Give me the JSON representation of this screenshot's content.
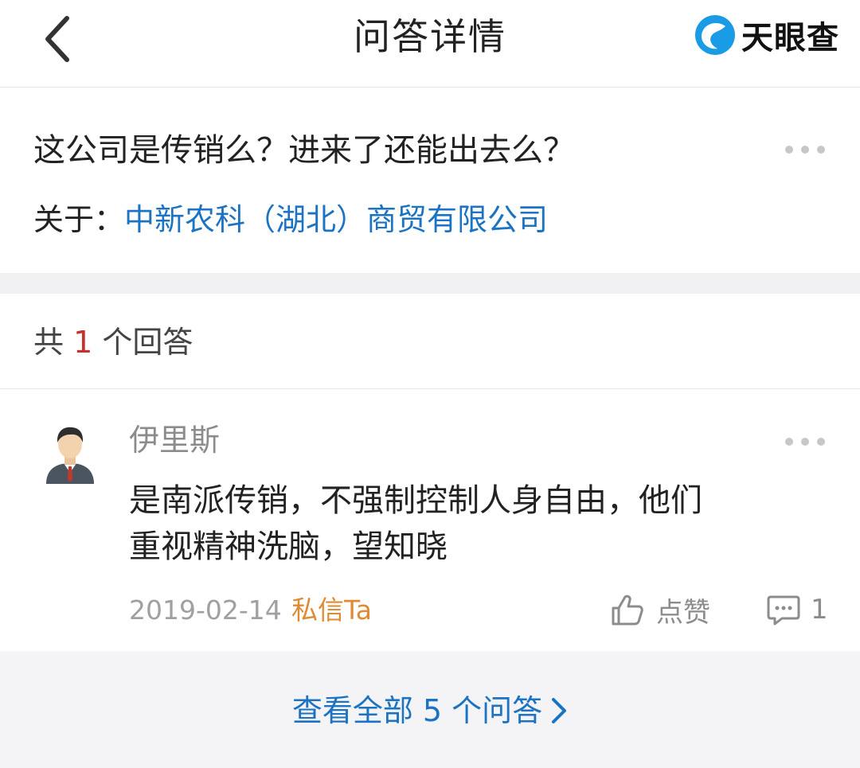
{
  "header": {
    "title": "问答详情",
    "brand": "天眼查",
    "brand_color": "#1a9be6"
  },
  "question": {
    "text": "这公司是传销么？进来了还能出去么？",
    "about_label": "关于：",
    "company": "中新农科（湖北）商贸有限公司"
  },
  "answers": {
    "count_prefix": "共",
    "count": "1",
    "count_suffix": "个回答"
  },
  "answer": {
    "user": "伊里斯",
    "lines": [
      "是南派传销，不强制控制人身自由，他们",
      "重视精神洗脑，望知晓"
    ],
    "date": "2019-02-14",
    "message_label": "私信Ta",
    "like_label": "点赞",
    "comment_count": "1"
  },
  "footer": {
    "view_all": "查看全部 5 个问答"
  },
  "colors": {
    "link": "#1b73c2",
    "count_highlight": "#c8302c",
    "message": "#e08a33",
    "muted": "#8c8c8c"
  }
}
